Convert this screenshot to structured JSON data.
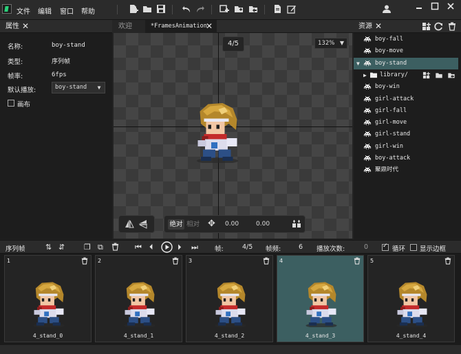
{
  "menu": [
    "文件",
    "编辑",
    "窗口",
    "帮助"
  ],
  "props_panel": {
    "tab": "属性",
    "fields": [
      {
        "label": "名称:",
        "value": "boy-stand"
      },
      {
        "label": "类型:",
        "value": "序列帧"
      },
      {
        "label": "帧率:",
        "value": "6fps"
      }
    ],
    "default_play_label": "默认播放:",
    "default_play_value": "boy-stand",
    "canvas_checkbox": "画布"
  },
  "editor_tabs": [
    {
      "label": "欢迎",
      "active": false
    },
    {
      "label": "*FramesAnimation",
      "active": true
    }
  ],
  "canvas": {
    "frame_badge": "4/5",
    "zoom": "132%",
    "mode_absolute": "绝对",
    "mode_relative": "相对",
    "x": "0.00",
    "y": "0.00"
  },
  "resources": {
    "tab": "资源",
    "items": [
      {
        "label": "boy-fall",
        "type": "anim",
        "indent": 0,
        "selected": false
      },
      {
        "label": "boy-move",
        "type": "anim",
        "indent": 0,
        "selected": false
      },
      {
        "label": "boy-stand",
        "type": "anim",
        "indent": 0,
        "selected": true
      },
      {
        "label": "library/",
        "type": "folder",
        "indent": 1,
        "selected": false
      },
      {
        "label": "boy-win",
        "type": "anim",
        "indent": 0,
        "selected": false
      },
      {
        "label": "girl-attack",
        "type": "anim",
        "indent": 0,
        "selected": false
      },
      {
        "label": "girl-fall",
        "type": "anim",
        "indent": 0,
        "selected": false
      },
      {
        "label": "girl-move",
        "type": "anim",
        "indent": 0,
        "selected": false
      },
      {
        "label": "girl-stand",
        "type": "anim",
        "indent": 0,
        "selected": false
      },
      {
        "label": "girl-win",
        "type": "anim",
        "indent": 0,
        "selected": false
      },
      {
        "label": "boy-attack",
        "type": "anim",
        "indent": 0,
        "selected": false
      },
      {
        "label": "聚鼎时代",
        "type": "anim",
        "indent": 0,
        "selected": false
      }
    ]
  },
  "timeline": {
    "tab": "序列帧",
    "frame_label": "帧:",
    "frame_value": "4/5",
    "rate_label": "帧频:",
    "rate_value": "6",
    "plays_label": "播放次数:",
    "plays_value": "0",
    "loop_label": "循环",
    "loop_checked": true,
    "border_label": "显示边框",
    "border_checked": false
  },
  "frames": [
    {
      "num": "1",
      "name": "4_stand_0",
      "selected": false
    },
    {
      "num": "2",
      "name": "4_stand_1",
      "selected": false
    },
    {
      "num": "3",
      "name": "4_stand_2",
      "selected": false
    },
    {
      "num": "4",
      "name": "4_stand_3",
      "selected": true
    },
    {
      "num": "5",
      "name": "4_stand_4",
      "selected": false
    }
  ],
  "icons": {
    "anim": "invader-icon",
    "folder": "folder-icon"
  },
  "colors": {
    "selection": "#3c5f61",
    "logo_green": "#2ad07a"
  }
}
